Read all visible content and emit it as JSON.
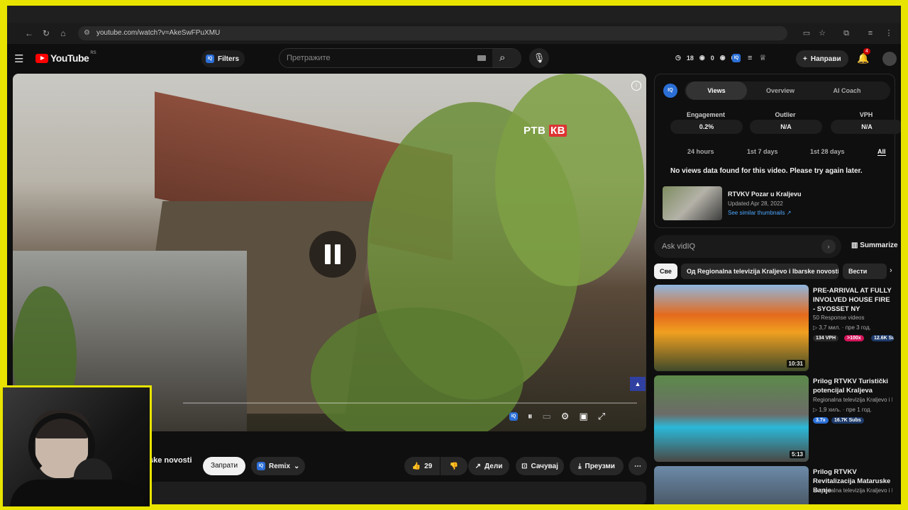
{
  "browser": {
    "url": "youtube.com/watch?v=AkeSwFPuXMU"
  },
  "header": {
    "logo_text": "YouTube",
    "region": "RS",
    "filters_label": "Filters",
    "search_placeholder": "Претражите",
    "stat_time": "18",
    "stat_views": "0",
    "stat_other": "0",
    "create_label": "Направи",
    "notifications": "4"
  },
  "video": {
    "watermark_ptb": "РТВ",
    "watermark_kb": "КВ"
  },
  "below": {
    "channel_name_partial": "ske novosti",
    "subscribe": "Запрати",
    "remix": "Remix",
    "likes": "29",
    "share": "Дели",
    "save": "Сачувај",
    "download": "Преузми"
  },
  "vidiq": {
    "tabs": [
      "Views",
      "Overview",
      "AI Coach"
    ],
    "metrics": [
      {
        "label": "Engagement",
        "value": "0.2%"
      },
      {
        "label": "Outlier",
        "value": "N/A"
      },
      {
        "label": "VPH",
        "value": "N/A"
      }
    ],
    "ranges": [
      "24 hours",
      "1st 7 days",
      "1st 28 days",
      "All"
    ],
    "no_data": "No views data found for this video. Please try again later.",
    "video_title": "RTVKV Pozar u Kraljevu",
    "updated": "Updated Apr 28, 2022",
    "similar": "See similar thumbnails ↗"
  },
  "ask": {
    "placeholder": "Ask vidIQ",
    "summarize": "Summarize"
  },
  "chips": [
    "Све",
    "Од Regionalna televizija Kraljevo i Ibarske novosti",
    "Вести"
  ],
  "recs": [
    {
      "title": "PRE-ARRIVAL AT FULLY INVOLVED HOUSE FIRE - SYOSSET NY",
      "channel": "50 Response videos",
      "meta": "▷ 3,7 мил. · пре 3 год.",
      "vph": "134 VPH",
      "outlier": ">100x",
      "subs": "12.6K Subs",
      "duration": "10:31"
    },
    {
      "title": "Prilog RTVKV Turistički potencijal Kraljeva",
      "channel": "Regionalna televizija Kraljevo i Ib",
      "meta": "▷ 1,9 хиљ. · пре 1 год.",
      "outlier": "3.7x",
      "subs": "16.7K Subs",
      "duration": "5:13"
    },
    {
      "title": "Prilog RTVKV Revitalizacija Mataruske Banje",
      "channel": "Regionalna televizija Kraljevo i Ib"
    }
  ],
  "colors": {
    "accent_yellow": "#e8e400",
    "yt_red": "#ff0000",
    "vidiq_blue": "#2b6fd6",
    "link_blue": "#4ea8ff"
  }
}
